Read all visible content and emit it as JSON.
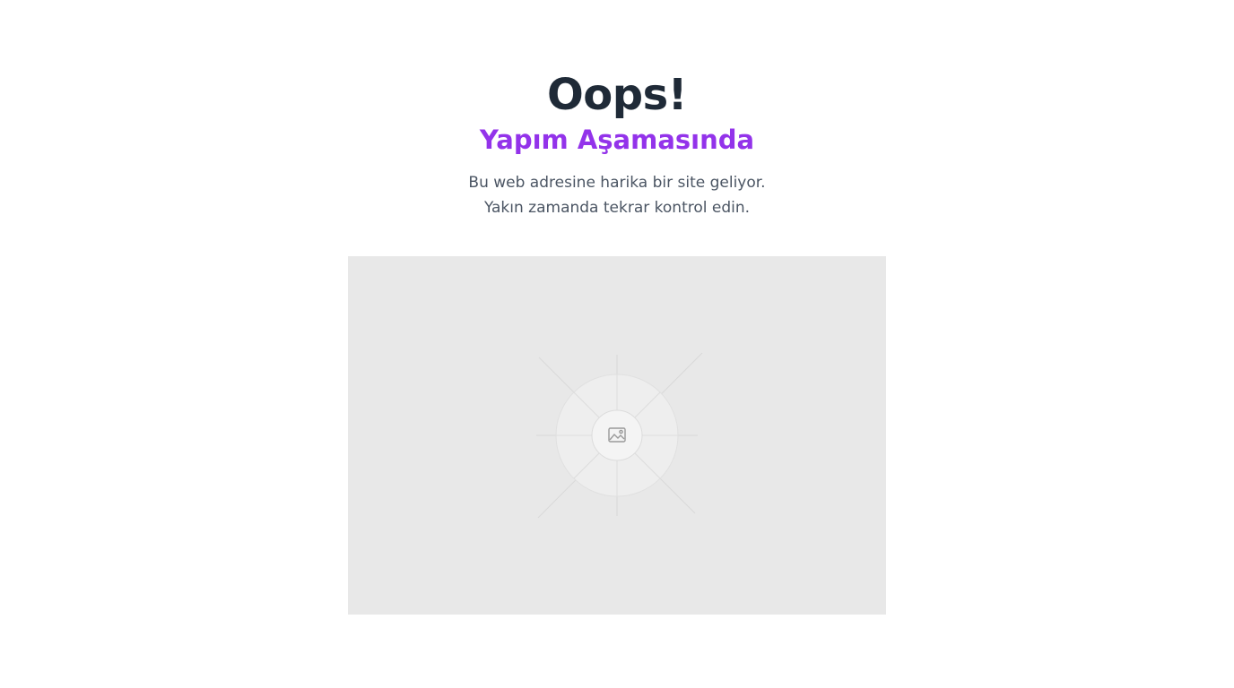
{
  "heading": {
    "title": "Oops!",
    "subtitle": "Yapım Aşamasında"
  },
  "message": {
    "line1": "Bu web adresine harika bir site geliyor.",
    "line2": "Yakın zamanda tekrar kontrol edin."
  },
  "placeholder": {
    "icon": "image-icon"
  },
  "colors": {
    "title": "#1f2a37",
    "accent": "#9333ea",
    "text": "#4b5563",
    "placeholder_bg": "#e8e8e8"
  }
}
